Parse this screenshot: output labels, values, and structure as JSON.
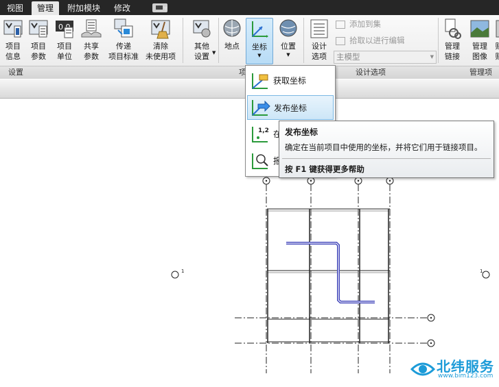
{
  "menubar": {
    "tabs": [
      "视图",
      "管理",
      "附加模块",
      "修改"
    ],
    "active_tab": "管理"
  },
  "ribbon": {
    "buttons": [
      {
        "l1": "项目",
        "l2": "信息"
      },
      {
        "l1": "项目",
        "l2": "参数"
      },
      {
        "l1": "项目",
        "l2": "单位"
      },
      {
        "l1": "共享",
        "l2": "参数"
      },
      {
        "l1": "传递",
        "l2": "项目标准"
      },
      {
        "l1": "清除",
        "l2": "未使用项"
      },
      {
        "l1": "其他",
        "l2": "设置"
      },
      {
        "l1": "地点",
        "l2": ""
      },
      {
        "l1": "坐标",
        "l2": ""
      },
      {
        "l1": "位置",
        "l2": ""
      },
      {
        "l1": "设计",
        "l2": "选项"
      },
      {
        "l1": "管理",
        "l2": "链接"
      },
      {
        "l1": "管理",
        "l2": "图像"
      },
      {
        "l1": "贴",
        "l2": "贴"
      }
    ],
    "design_options": {
      "add_to_set": "添加到集",
      "pick_to_edit": "拾取以进行编辑",
      "main_model": "主模型"
    },
    "groups": {
      "settings": "设置",
      "project_location_partial": "项",
      "design_options": "设计选项",
      "manage_project_partial": "管理项"
    }
  },
  "coordinates_menu": {
    "items": [
      "获取坐标",
      "发布坐标",
      "在",
      "报"
    ],
    "highlighted": "发布坐标"
  },
  "tooltip": {
    "title": "发布坐标",
    "description": "确定在当前项目中使用的坐标，并将它们用于链接项目。",
    "help": "按 F1 键获得更多帮助"
  },
  "drawing": {
    "grid_badge_1_label": "1",
    "grid_badge_2_label": "1"
  },
  "watermark": {
    "brand": "北纬服务",
    "url": "www.bim123.com"
  },
  "colors": {
    "accent": "#3b7fd0",
    "wall_blue": "#3a3fb8",
    "watermark": "#1c9bd8"
  }
}
